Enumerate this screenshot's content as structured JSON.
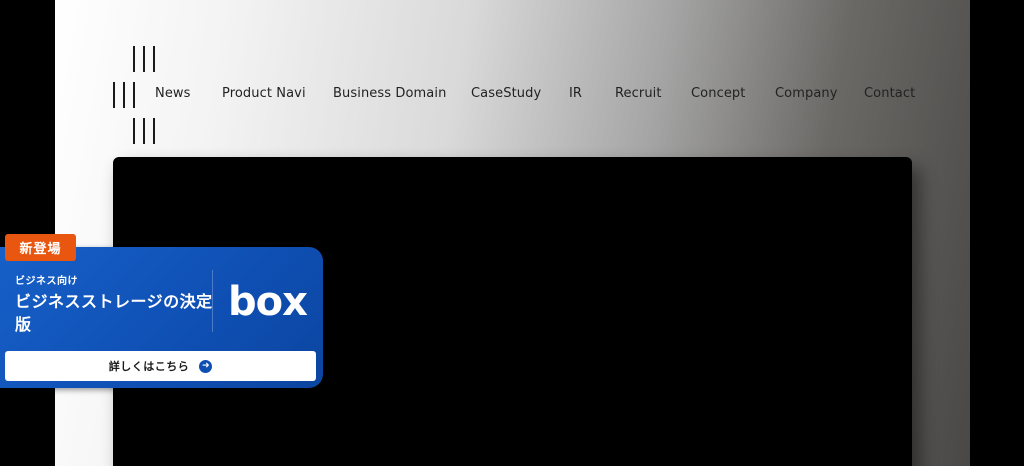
{
  "nav": {
    "items": [
      "News",
      "Product Navi",
      "Business Domain",
      "CaseStudy",
      "IR",
      "Recruit",
      "Concept",
      "Company",
      "Contact"
    ]
  },
  "banner": {
    "badge": "新登場",
    "subtitle": "ビジネス向け",
    "title": "ビジネスストレージの決定版",
    "brand": "box",
    "cta_label": "詳しくはこちら",
    "cta_icon": "arrow-right-circle-icon",
    "colors": {
      "primary": "#0f4fb3",
      "badge": "#e9560f"
    }
  }
}
